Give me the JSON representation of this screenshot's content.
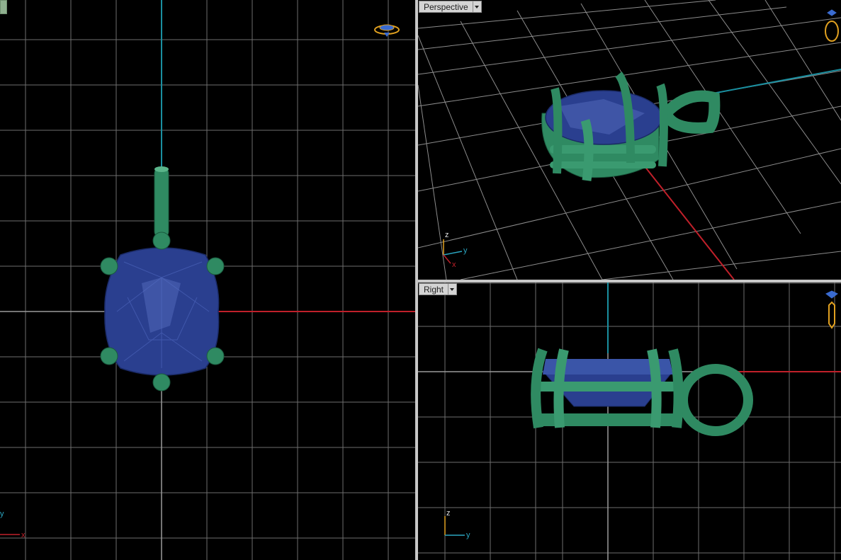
{
  "viewports": {
    "top": {
      "label": "",
      "axis_labels": {
        "y": "y",
        "x": "x"
      }
    },
    "perspective": {
      "label": "Perspective",
      "axis_labels": {
        "z": "z",
        "y": "y",
        "x": "x"
      }
    },
    "right": {
      "label": "Right",
      "axis_labels": {
        "z": "z",
        "y": "y"
      }
    }
  },
  "colors": {
    "background": "#000000",
    "grid": "#7a7a7a",
    "axis_x": "#c0202a",
    "axis_y": "#1a8fa0",
    "metal": "#2f8a62",
    "stone": "#2a3f8f",
    "frame": "#c8c8c8"
  },
  "icons": [
    "ring-gem-icon",
    "dropdown-arrow-icon",
    "axis-gizmo-icon"
  ]
}
